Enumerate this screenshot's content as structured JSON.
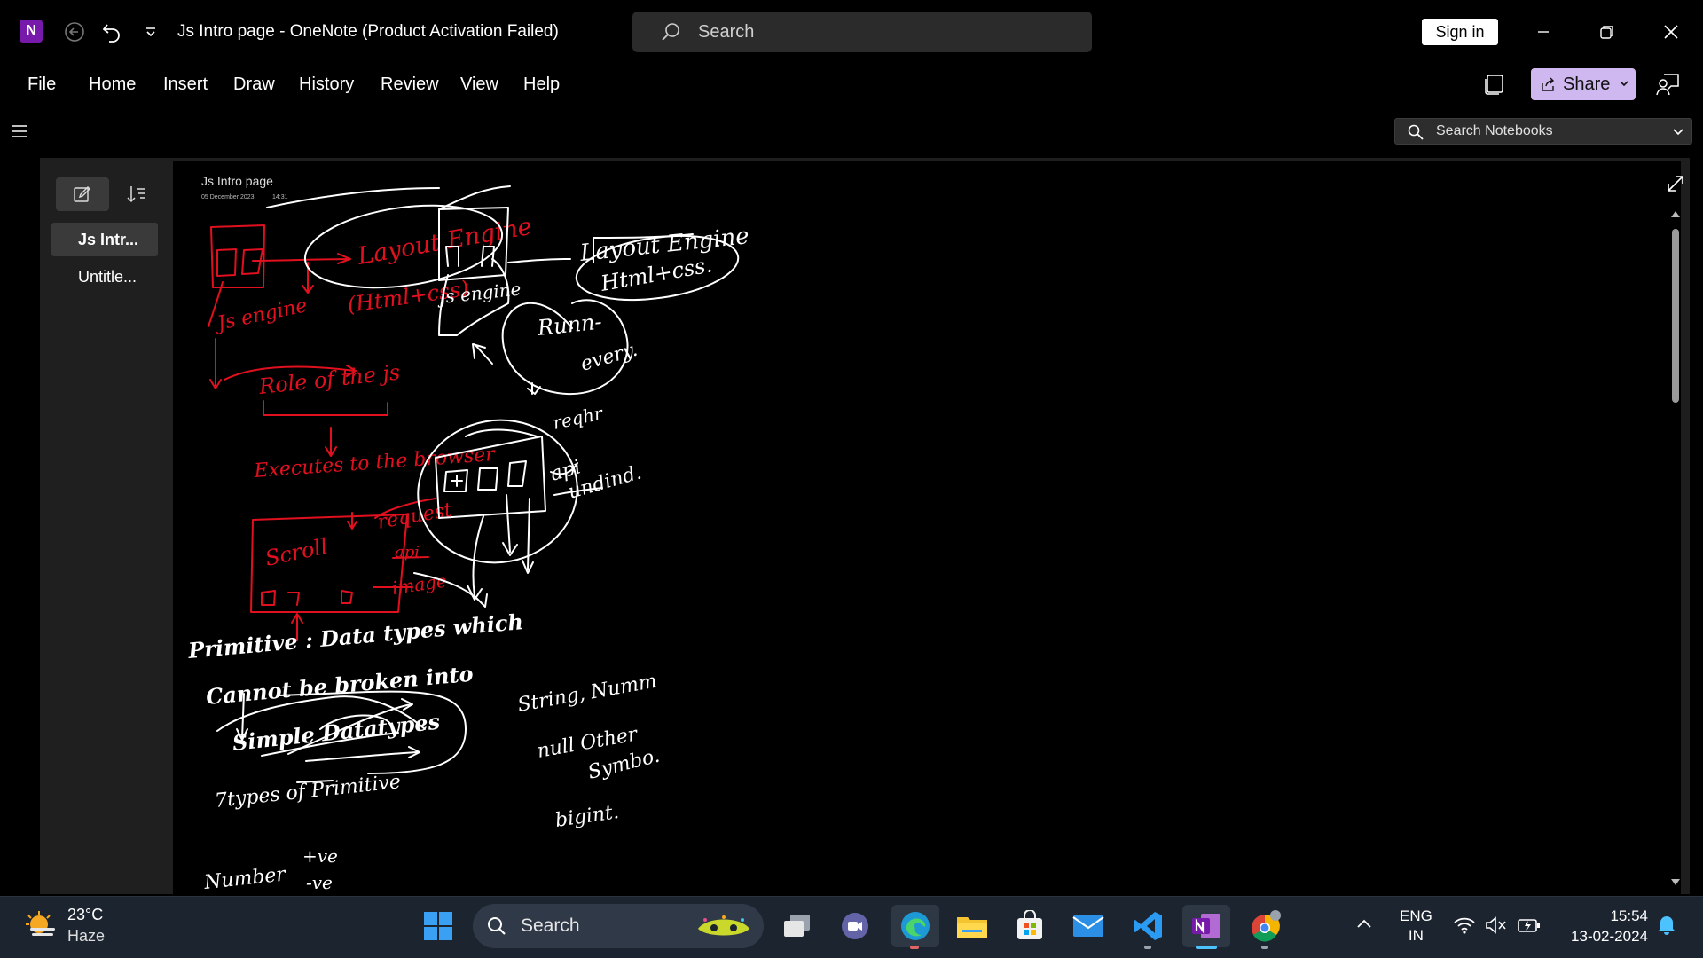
{
  "window": {
    "title": "Js Intro page  -  OneNote (Product Activation Failed)",
    "search_label": "Search",
    "sign_in": "Sign in",
    "logo_letter": "N"
  },
  "menu": {
    "items": [
      "File",
      "Home",
      "Insert",
      "Draw",
      "History",
      "Review",
      "View",
      "Help"
    ],
    "share": "Share"
  },
  "notebook_search": {
    "placeholder": "Search Notebooks"
  },
  "pages": [
    {
      "label": "Js Intr...",
      "active": true
    },
    {
      "label": "Untitle...",
      "active": false
    }
  ],
  "page": {
    "title": "Js Intro page",
    "date": "05 December 2023",
    "time": "14:31"
  },
  "ink_text": {
    "red_1": "Layout Engine",
    "red_2": "(Html+css)",
    "red_3": "Js engine",
    "red_4": "Role of the js",
    "red_5": "Executes to the browser",
    "red_6": "Scroll",
    "red_7": "request",
    "red_8": "api",
    "red_9": "image",
    "white_1": "Layout Engine",
    "white_2": "Html+css.",
    "white_3": "js engine",
    "white_4": "Runn-",
    "white_5": "every.",
    "white_6": "reqhr",
    "white_7": "api",
    "white_8": "undind.",
    "white_9": "Primitive : Data types which",
    "white_10": "Cannot be broken into",
    "white_11": "Simple Datatypes",
    "white_12": "7types of Primitive",
    "white_13": "String, Numm",
    "white_14": "null Other",
    "white_15": "Symbo.",
    "white_16": "bigint.",
    "white_17": "+ve",
    "white_18": "Number",
    "white_19": "-ve"
  },
  "taskbar": {
    "temp": "23°C",
    "condition": "Haze",
    "search_label": "Search",
    "lang_1": "ENG",
    "lang_2": "IN",
    "time": "15:54",
    "date": "13-02-2024"
  },
  "colors": {
    "ink_red": "#e0101f",
    "ink_white": "#ffffff",
    "onenote_purple": "#7719aa",
    "share_bg": "#cfb7ef"
  }
}
